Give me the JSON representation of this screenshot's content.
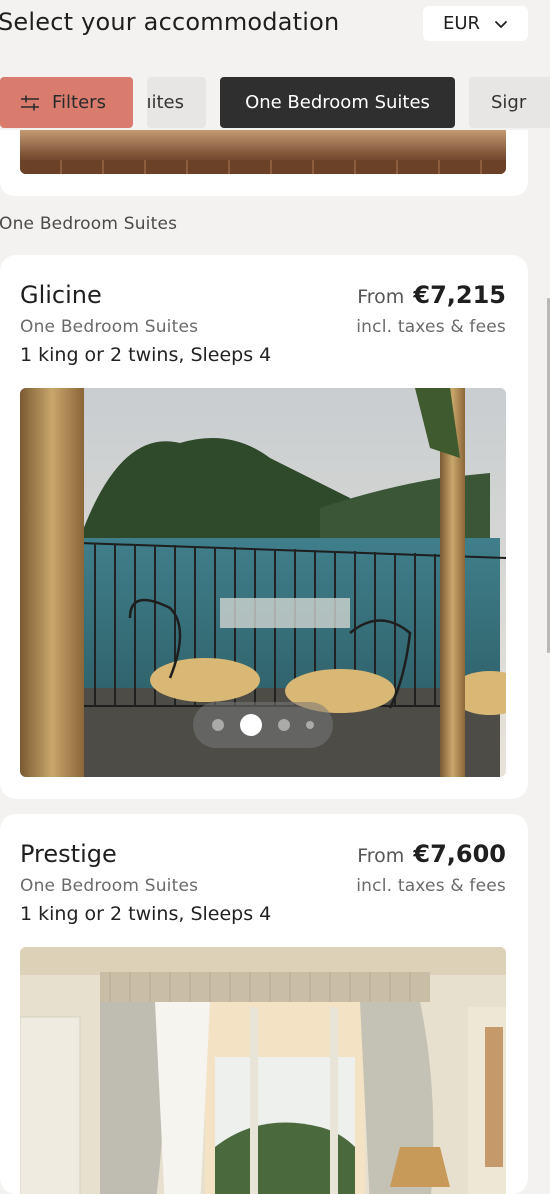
{
  "header": {
    "title": "Select your accommodation",
    "currency": {
      "value": "EUR",
      "icon": "chevron-down-icon"
    }
  },
  "filters": {
    "filters_label": "Filters",
    "filters_icon": "sliders-icon",
    "chips": [
      "ıites",
      "One Bedroom Suites",
      "Sigr"
    ],
    "active_chip": "One Bedroom Suites"
  },
  "section": {
    "label": "One Bedroom Suites"
  },
  "rooms": [
    {
      "name": "Glicine",
      "category": "One Bedroom Suites",
      "beds": "1 king or 2 twins, Sleeps 4",
      "price_prefix": "From",
      "price": "€7,215",
      "price_note": "incl. taxes & fees",
      "carousel": {
        "total": 4,
        "active_index": 1
      }
    },
    {
      "name": "Prestige",
      "category": "One Bedroom Suites",
      "beds": "1 king or 2 twins, Sleeps 4",
      "price_prefix": "From",
      "price": "€7,600",
      "price_note": "incl. taxes & fees"
    }
  ],
  "colors": {
    "filters_chip": "#d97c6e",
    "active_chip": "#2f2f2f",
    "inactive_chip": "#e7e6e4",
    "background": "#f3f2f0"
  }
}
